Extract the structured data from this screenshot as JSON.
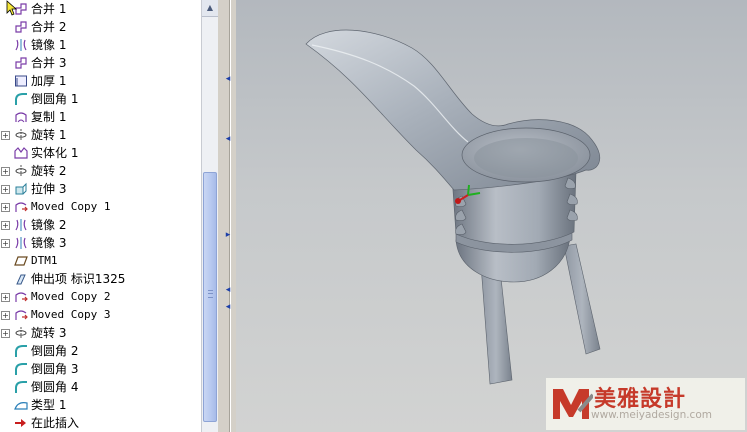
{
  "model_tree": {
    "items": [
      {
        "label": "合并 1",
        "icon": "merge-icon",
        "expandable": false,
        "latin": false
      },
      {
        "label": "合并 2",
        "icon": "merge-icon",
        "expandable": false,
        "latin": false
      },
      {
        "label": "镜像 1",
        "icon": "mirror-icon",
        "expandable": false,
        "latin": false
      },
      {
        "label": "合并 3",
        "icon": "merge-icon",
        "expandable": false,
        "latin": false
      },
      {
        "label": "加厚 1",
        "icon": "thicken-icon",
        "expandable": false,
        "latin": false
      },
      {
        "label": "倒圆角 1",
        "icon": "round-icon",
        "expandable": false,
        "latin": false
      },
      {
        "label": "复制 1",
        "icon": "copy-icon",
        "expandable": false,
        "latin": false
      },
      {
        "label": "旋转 1",
        "icon": "revolve-icon",
        "expandable": true,
        "latin": false
      },
      {
        "label": "实体化 1",
        "icon": "solidify-icon",
        "expandable": false,
        "latin": false
      },
      {
        "label": "旋转 2",
        "icon": "revolve-icon",
        "expandable": true,
        "latin": false
      },
      {
        "label": "拉伸 3",
        "icon": "extrude-icon",
        "expandable": true,
        "latin": false
      },
      {
        "label": "Moved Copy 1",
        "icon": "moved-copy-icon",
        "expandable": true,
        "latin": true
      },
      {
        "label": "镜像 2",
        "icon": "mirror-icon",
        "expandable": true,
        "latin": false
      },
      {
        "label": "镜像 3",
        "icon": "mirror-icon",
        "expandable": true,
        "latin": false
      },
      {
        "label": "DTM1",
        "icon": "datum-plane-icon",
        "expandable": false,
        "latin": true
      },
      {
        "label": "伸出项 标识1325",
        "icon": "protrusion-icon",
        "expandable": false,
        "latin": false
      },
      {
        "label": "Moved Copy 2",
        "icon": "moved-copy-icon",
        "expandable": true,
        "latin": true
      },
      {
        "label": "Moved Copy 3",
        "icon": "moved-copy-icon",
        "expandable": true,
        "latin": true
      },
      {
        "label": "旋转 3",
        "icon": "revolve-icon",
        "expandable": true,
        "latin": false
      },
      {
        "label": "倒圆角 2",
        "icon": "round-icon",
        "expandable": false,
        "latin": false
      },
      {
        "label": "倒圆角 3",
        "icon": "round-icon",
        "expandable": false,
        "latin": false
      },
      {
        "label": "倒圆角 4",
        "icon": "round-icon",
        "expandable": false,
        "latin": false
      },
      {
        "label": "类型 1",
        "icon": "type-icon",
        "expandable": false,
        "latin": false
      },
      {
        "label": "在此插入",
        "icon": "insert-here-arrow-icon",
        "expandable": false,
        "latin": false
      }
    ],
    "expander_symbol": "+"
  },
  "watermark": {
    "title": "美雅設計",
    "url": "www.meiyadesign.com",
    "brand_color": "#c63a2a"
  },
  "colors": {
    "viewport_bg": "#c6c9cb",
    "model_color": "#9ea6b0",
    "scroll_thumb": "#b6c8ef",
    "splitter_handle": "#1c3fa8"
  }
}
